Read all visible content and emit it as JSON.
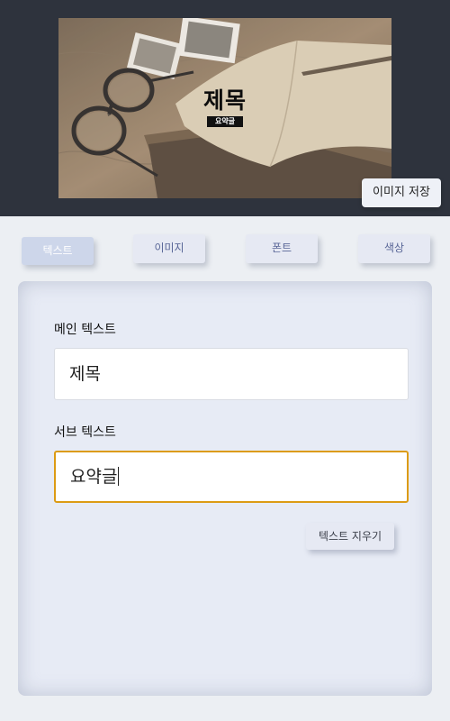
{
  "preview": {
    "image_description": "desk with glasses, open notebook, pencil and old photos on a map",
    "title": "제목",
    "subtitle": "요약글"
  },
  "toolbar": {
    "save_label": "이미지 저장"
  },
  "tabs": [
    {
      "label": "텍스트",
      "active": true
    },
    {
      "label": "이미지",
      "active": false
    },
    {
      "label": "폰트",
      "active": false
    },
    {
      "label": "색상",
      "active": false
    }
  ],
  "text_panel": {
    "main_label": "메인 텍스트",
    "main_value": "제목",
    "sub_label": "서브 텍스트",
    "sub_value": "요약글",
    "clear_label": "텍스트 지우기"
  },
  "colors": {
    "header_bg": "#2e333d",
    "focus_border": "#dc9b14",
    "tab_text": "#5a6798",
    "active_tab_bg": "#cdd6ea",
    "panel_bg": "#e7ebf5"
  }
}
